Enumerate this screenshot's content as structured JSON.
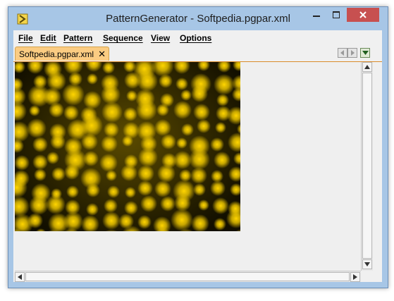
{
  "window": {
    "title": "PatternGenerator - Softpedia.pgpar.xml"
  },
  "menu": {
    "items": [
      {
        "label": "File"
      },
      {
        "label": "Edit"
      },
      {
        "label": "Pattern"
      },
      {
        "label": "Sequence"
      },
      {
        "label": "View"
      },
      {
        "label": "Options"
      }
    ]
  },
  "tabs": [
    {
      "label": "Softpedia.pgpar.xml",
      "close": "✕"
    }
  ],
  "colors": {
    "pattern_dark": "#120f00",
    "pattern_bright": "#ffd500",
    "tab_active": "#fbcc82"
  }
}
